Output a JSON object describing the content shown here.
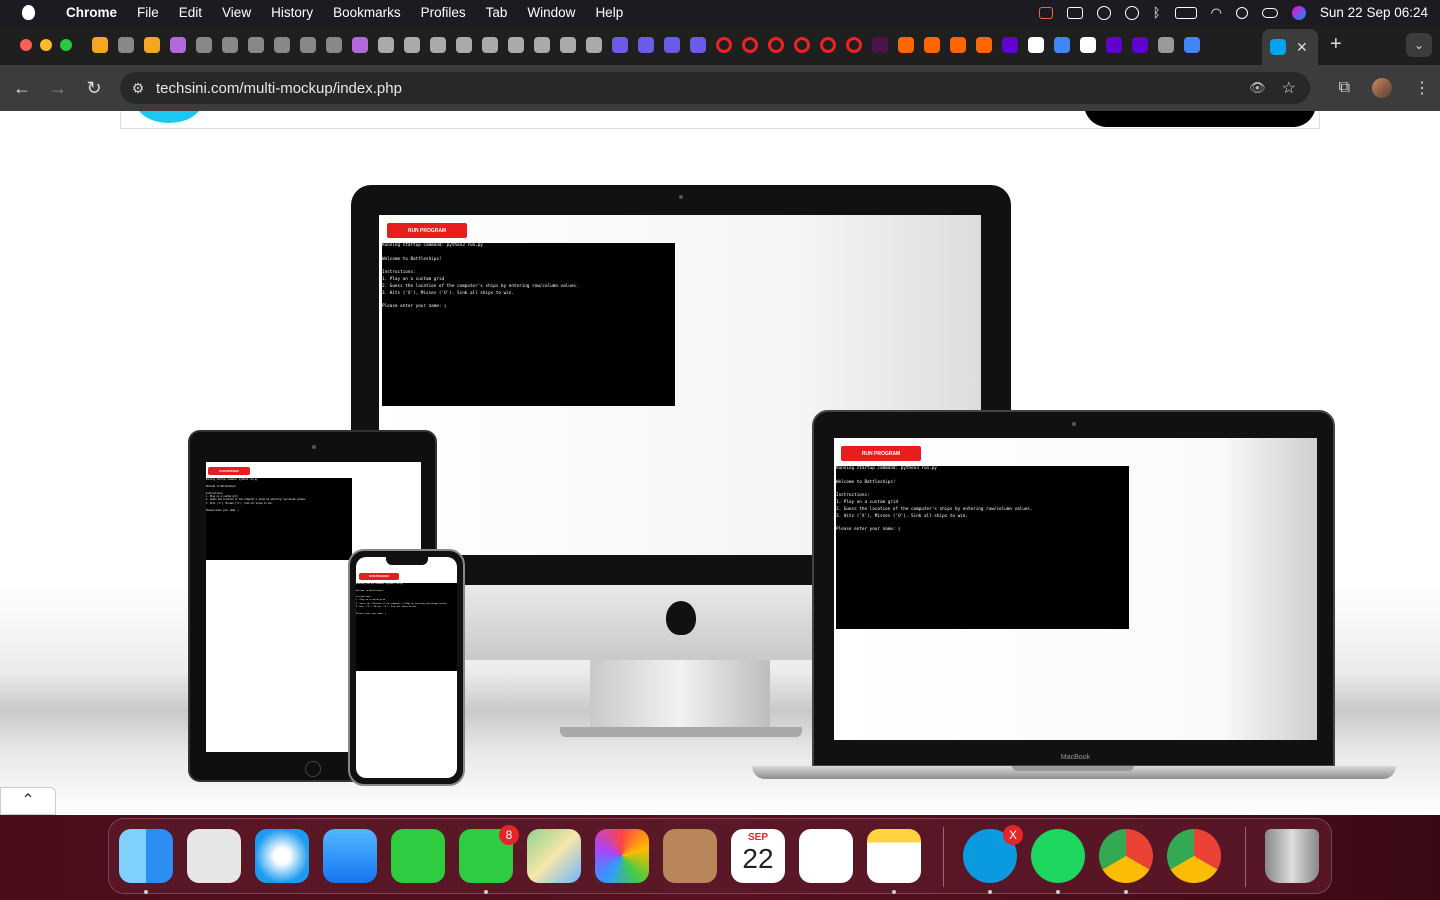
{
  "menubar": {
    "app_name": "Chrome",
    "items": [
      "File",
      "Edit",
      "View",
      "History",
      "Bookmarks",
      "Profiles",
      "Tab",
      "Window",
      "Help"
    ],
    "clock": "Sun 22 Sep  06:24"
  },
  "tabs": {
    "pinned_count": 44,
    "active_close": "✕",
    "new_tab": "+",
    "tab_menu": "⌄"
  },
  "toolbar": {
    "back": "←",
    "forward": "→",
    "reload": "↻",
    "url": "techsini.com/multi-mockup/index.php",
    "tune": "⚙",
    "eye_off": "👁",
    "bookmark": "☆",
    "extensions": "⧉",
    "menu": "⋮"
  },
  "terminal": {
    "run_label": "RUN PROGRAM",
    "lines": [
      "Running startup command: python3 run.py",
      "",
      "Welcome to Battleships!",
      "",
      "Instructions:",
      "1. Play on a custom grid",
      "2. Guess the location of the computer's ships by entering row/column values.",
      "3. Hits ('X'), Misses ('O'). Sink all ships to win.",
      "",
      "Please enter your name: ▯"
    ]
  },
  "laptop": {
    "label": "MacBook"
  },
  "scroll_top": "⌃",
  "dock": {
    "calendar_month": "SEP",
    "calendar_day": "22",
    "messages_badge": "8",
    "skype_badge": "X",
    "apps": [
      "Finder",
      "Launchpad",
      "Safari",
      "Mail",
      "FaceTime",
      "Messages",
      "Maps",
      "Photos",
      "Contacts",
      "Calendar",
      "Reminders",
      "Notes",
      "Skype",
      "Spotify",
      "Google Chrome",
      "Google Chrome",
      "Trash"
    ]
  }
}
